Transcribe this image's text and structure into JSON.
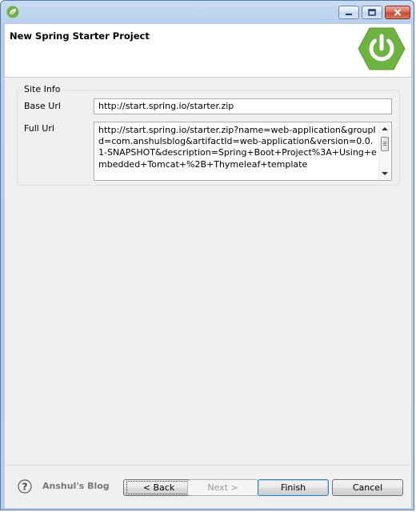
{
  "header": {
    "title": "New Spring Starter Project",
    "logo_color": "#6db33f"
  },
  "site_info": {
    "group_title": "Site Info",
    "base_url_label": "Base Url",
    "base_url_value": "http://start.spring.io/starter.zip",
    "full_url_label": "Full Url",
    "full_url_value": "http://start.spring.io/starter.zip?name=web-application&groupId=com.anshulsblog&artifactId=web-application&version=0.0.1-SNAPSHOT&description=Spring+Boot+Project%3A+Using+embedded+Tomcat+%2B+Thymeleaf+template"
  },
  "footer": {
    "brand": "Anshul's Blog",
    "back_label": "< Back",
    "next_label": "Next >",
    "finish_label": "Finish",
    "cancel_label": "Cancel"
  },
  "icons": {
    "app": "spring-leaf-icon",
    "help": "help-icon",
    "logo": "spring-power-icon"
  }
}
